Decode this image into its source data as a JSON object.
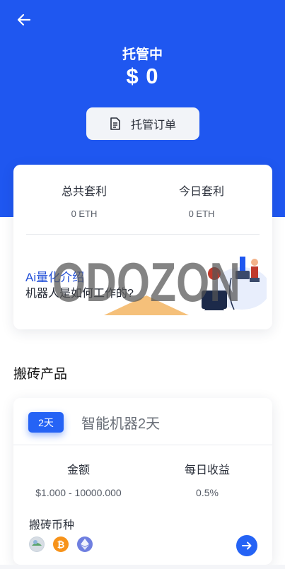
{
  "header": {
    "status_title": "托管中",
    "amount": "$ 0",
    "order_button_label": "托管订单"
  },
  "summary": {
    "total_label": "总共套利",
    "total_value": "0 ETH",
    "today_label": "今日套利",
    "today_value": "0 ETH"
  },
  "ai_intro": {
    "title": "Ai量化介绍",
    "subtitle": "机器人是如何工作的?"
  },
  "watermark": "ODOZON",
  "section": {
    "title": "搬砖产品"
  },
  "product": {
    "badge": "2天",
    "name": "智能机器2天",
    "amount_label": "金额",
    "amount_value": "$1.000 - 10000.000",
    "daily_label": "每日收益",
    "daily_value": "0.5%",
    "coins_label": "搬砖币种",
    "coins": [
      {
        "icon": "generic-coin-icon",
        "color": "#9aa7b5"
      },
      {
        "icon": "bitcoin-icon",
        "color": "#f7931a",
        "glyph": "₿"
      },
      {
        "icon": "ethereum-icon",
        "color": "#6f7fe0",
        "glyph": "♦"
      }
    ]
  },
  "colors": {
    "primary": "#1f57f0",
    "accent": "#2563f5"
  }
}
